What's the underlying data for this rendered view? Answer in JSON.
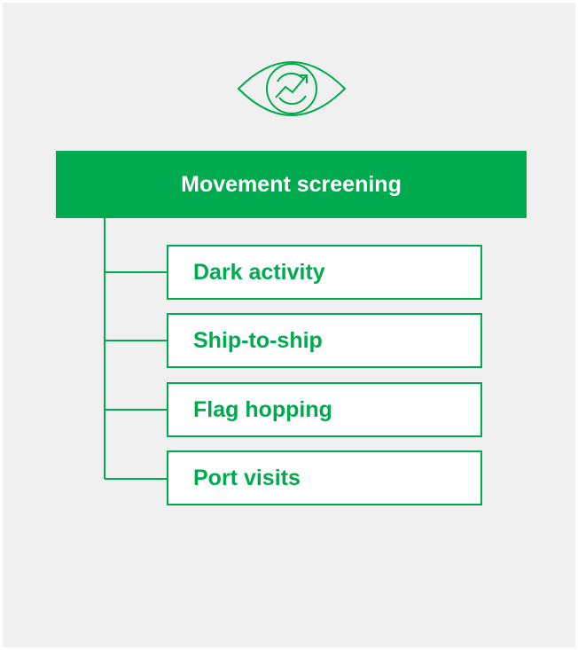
{
  "colors": {
    "accent": "#00aa4e",
    "background": "#f0f0f0",
    "box_fill": "#ffffff",
    "header_text": "#ffffff"
  },
  "icon": {
    "name": "eye-trend-icon"
  },
  "header": {
    "title": "Movement screening"
  },
  "items": [
    {
      "label": "Dark activity"
    },
    {
      "label": "Ship-to-ship"
    },
    {
      "label": "Flag hopping"
    },
    {
      "label": "Port visits"
    }
  ]
}
